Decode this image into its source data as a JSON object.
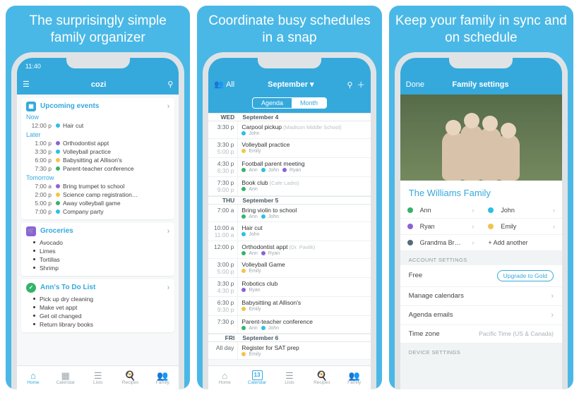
{
  "panel1": {
    "title": "The surprisingly simple family organizer",
    "time": "11:40",
    "brand": "cozi",
    "upcoming": {
      "header": "Upcoming events",
      "now_label": "Now",
      "now": [
        {
          "t": "12:00 p",
          "c": "#2bc0e4",
          "txt": "Hair cut"
        }
      ],
      "later_label": "Later",
      "later": [
        {
          "t": "1:00 p",
          "c": "#8c62d6",
          "txt": "Orthodontist appt"
        },
        {
          "t": "3:30 p",
          "c": "#2bc0e4",
          "txt": "Volleyball practice"
        },
        {
          "t": "6:00 p",
          "c": "#f2c44c",
          "txt": "Babysitting at Allison's"
        },
        {
          "t": "7:30 p",
          "c": "#34b36a",
          "txt": "Parent-teacher conference"
        }
      ],
      "tomorrow_label": "Tomorrow",
      "tomorrow": [
        {
          "t": "7:00 a",
          "c": "#8c62d6",
          "txt": "Bring trumpet to school"
        },
        {
          "t": "2:00 p",
          "c": "#f2c44c",
          "txt": "Science camp registration…"
        },
        {
          "t": "5:00 p",
          "c": "#34b36a",
          "txt": "Away volleyball game"
        },
        {
          "t": "7:00 p",
          "c": "#2bc0e4",
          "txt": "Company party"
        }
      ]
    },
    "groceries": {
      "header": "Groceries",
      "items": [
        "Avocado",
        "Limes",
        "Tortillas",
        "Shrimp"
      ]
    },
    "todo": {
      "header": "Ann's To Do List",
      "items": [
        "Pick up dry cleaning",
        "Make vet appt",
        "Get oil changed",
        "Return library books"
      ]
    },
    "tabs": [
      "Home",
      "Calendar",
      "Lists",
      "Recipes",
      "Family"
    ]
  },
  "panel2": {
    "title": "Coordinate busy schedules in a snap",
    "all": "All",
    "month": "September ▾",
    "seg": [
      "Agenda",
      "Month"
    ],
    "days": [
      {
        "dw": "WED",
        "date": "September 4",
        "rows": [
          {
            "t": "3:30 p",
            "e": "",
            "ttl": "Carpool pickup",
            "loc": "(Madison Middle School)",
            "who": [
              {
                "c": "#2bc0e4",
                "n": "John"
              }
            ]
          },
          {
            "t": "3:30 p",
            "e": "5:00 p",
            "ttl": "Volleyball practice",
            "loc": "",
            "who": [
              {
                "c": "#f2c44c",
                "n": "Emily"
              }
            ]
          },
          {
            "t": "4:30 p",
            "e": "6:30 p",
            "ttl": "Football parent meeting",
            "loc": "",
            "who": [
              {
                "c": "#34b36a",
                "n": "Ann"
              },
              {
                "c": "#2bc0e4",
                "n": "John"
              },
              {
                "c": "#8c62d6",
                "n": "Ryan"
              }
            ]
          },
          {
            "t": "7:30 p",
            "e": "9:00 p",
            "ttl": "Book club",
            "loc": "(Cafe Ladro)",
            "who": [
              {
                "c": "#34b36a",
                "n": "Ann"
              }
            ]
          }
        ]
      },
      {
        "dw": "THU",
        "date": "September 5",
        "rows": [
          {
            "t": "7:00 a",
            "e": "",
            "ttl": "Bring violin to school",
            "loc": "",
            "who": [
              {
                "c": "#34b36a",
                "n": "Ann"
              },
              {
                "c": "#2bc0e4",
                "n": "John"
              }
            ]
          },
          {
            "t": "10:00 a",
            "e": "11:00 a",
            "ttl": "Hair cut",
            "loc": "",
            "who": [
              {
                "c": "#2bc0e4",
                "n": "John"
              }
            ]
          },
          {
            "t": "12:00 p",
            "e": "",
            "ttl": "Orthodontist appt",
            "loc": "(Dr. Pavlik)",
            "who": [
              {
                "c": "#34b36a",
                "n": "Ann"
              },
              {
                "c": "#8c62d6",
                "n": "Ryan"
              }
            ]
          },
          {
            "t": "3:00 p",
            "e": "5:00 p",
            "ttl": "Volleyball Game",
            "loc": "",
            "who": [
              {
                "c": "#f2c44c",
                "n": "Emily"
              }
            ]
          },
          {
            "t": "3:30 p",
            "e": "4:30 p",
            "ttl": "Robotics club",
            "loc": "",
            "who": [
              {
                "c": "#8c62d6",
                "n": "Ryan"
              }
            ]
          },
          {
            "t": "6:30 p",
            "e": "9:30 p",
            "ttl": "Babysitting at Allison's",
            "loc": "",
            "who": [
              {
                "c": "#f2c44c",
                "n": "Emily"
              }
            ]
          },
          {
            "t": "7:30 p",
            "e": "",
            "ttl": "Parent-teacher conference",
            "loc": "",
            "who": [
              {
                "c": "#34b36a",
                "n": "Ann"
              },
              {
                "c": "#2bc0e4",
                "n": "John"
              }
            ]
          }
        ]
      },
      {
        "dw": "FRI",
        "date": "September 6",
        "rows": [
          {
            "t": "All day",
            "e": "",
            "ttl": "Register for SAT prep",
            "loc": "",
            "who": [
              {
                "c": "#f2c44c",
                "n": "Emily"
              }
            ]
          }
        ]
      }
    ],
    "tabs": [
      "Home",
      "Calendar",
      "Lists",
      "Recipes",
      "Family"
    ],
    "date_badge": "13"
  },
  "panel3": {
    "title": "Keep your family in sync and on schedule",
    "done": "Done",
    "header": "Family settings",
    "family_name": "The Williams Family",
    "members": [
      {
        "c": "#34b36a",
        "n": "Ann"
      },
      {
        "c": "#2bc0e4",
        "n": "John"
      },
      {
        "c": "#8c62d6",
        "n": "Ryan"
      },
      {
        "c": "#f2c44c",
        "n": "Emily"
      },
      {
        "c": "#5a6b7a",
        "n": "Grandma Br…"
      }
    ],
    "add_label": "+ Add another",
    "acct_hdr": "ACCOUNT SETTINGS",
    "free": "Free",
    "upgrade": "Upgrade to Gold",
    "rows": [
      "Manage calendars",
      "Agenda emails"
    ],
    "tz_label": "Time zone",
    "tz_val": "Pacific Time (US & Canada)",
    "dev_hdr": "DEVICE SETTINGS"
  }
}
